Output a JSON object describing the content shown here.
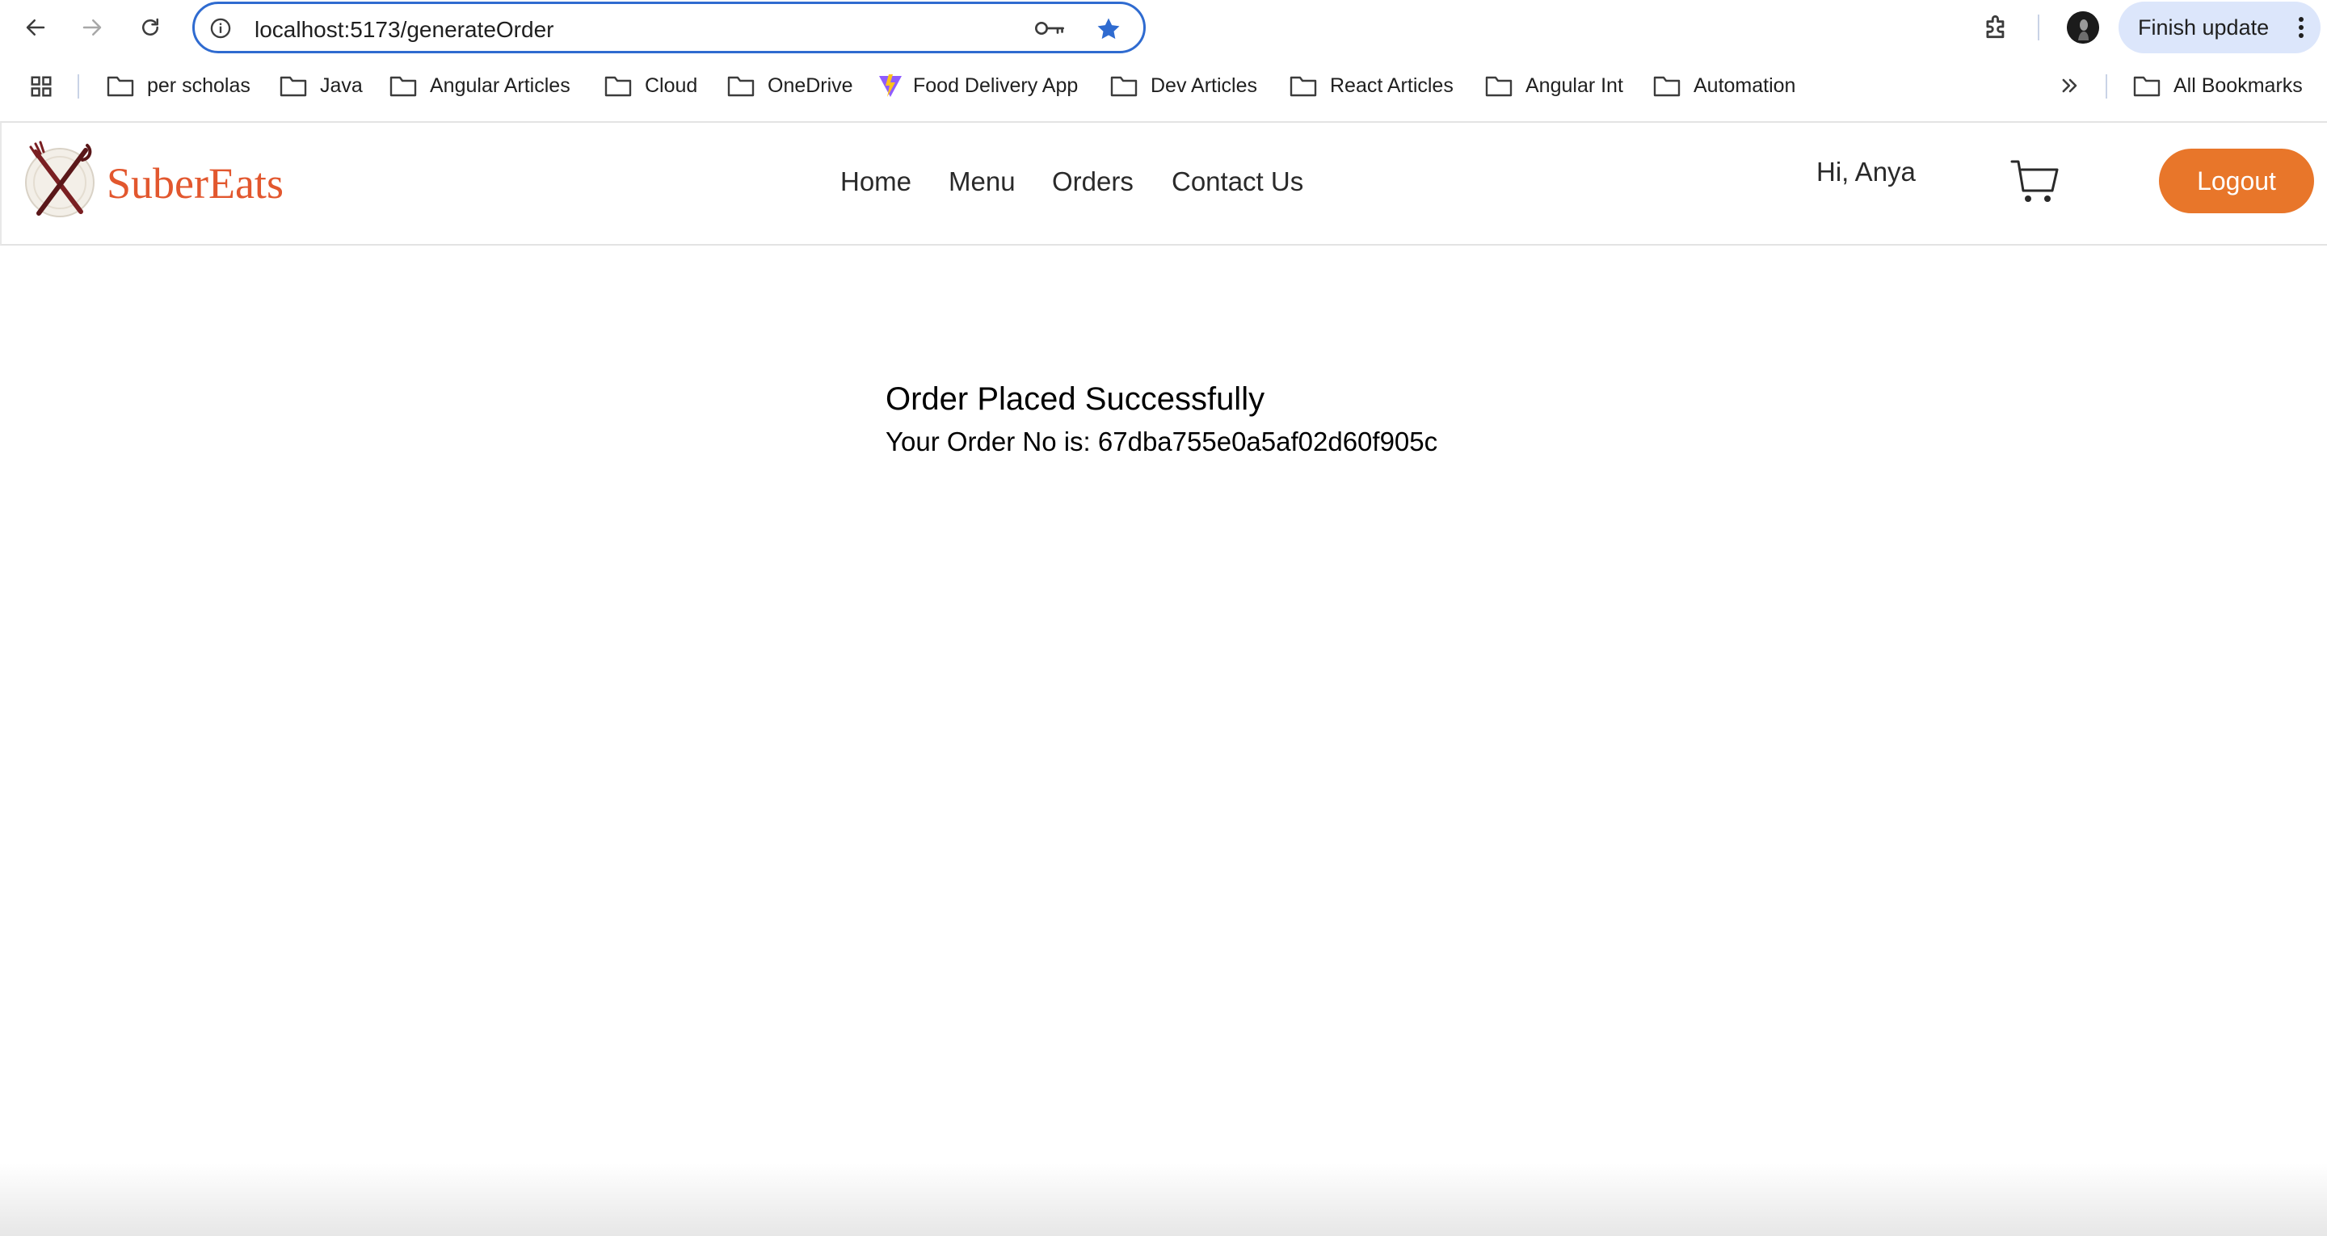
{
  "browser": {
    "url": "localhost:5173/generateOrder",
    "finish_update_label": "Finish update"
  },
  "bookmarks": {
    "items": [
      {
        "label": "per scholas",
        "icon": "folder-icon"
      },
      {
        "label": "Java",
        "icon": "folder-icon"
      },
      {
        "label": "Angular Articles",
        "icon": "folder-icon"
      },
      {
        "label": "Cloud",
        "icon": "folder-icon"
      },
      {
        "label": "OneDrive",
        "icon": "folder-icon"
      },
      {
        "label": "Food Delivery App",
        "icon": "vite-icon"
      },
      {
        "label": "Dev Articles",
        "icon": "folder-icon"
      },
      {
        "label": "React Articles",
        "icon": "folder-icon"
      },
      {
        "label": "Angular Int",
        "icon": "folder-icon"
      },
      {
        "label": "Automation",
        "icon": "folder-icon"
      }
    ],
    "all_bookmarks_label": "All Bookmarks"
  },
  "header": {
    "brand": "SuberEats",
    "nav": [
      {
        "label": "Home"
      },
      {
        "label": "Menu"
      },
      {
        "label": "Orders"
      },
      {
        "label": "Contact Us"
      }
    ],
    "greeting": "Hi, Anya",
    "logout_label": "Logout"
  },
  "main": {
    "title": "Order Placed Successfully",
    "order_label": "Your Order No is: 67dba755e0a5af02d60f905c"
  },
  "colors": {
    "brand": "#e2572e",
    "logout_button": "#e8762a",
    "omnibox_focus": "#2f6bd0",
    "finish_update_bg": "#dce6fb"
  }
}
